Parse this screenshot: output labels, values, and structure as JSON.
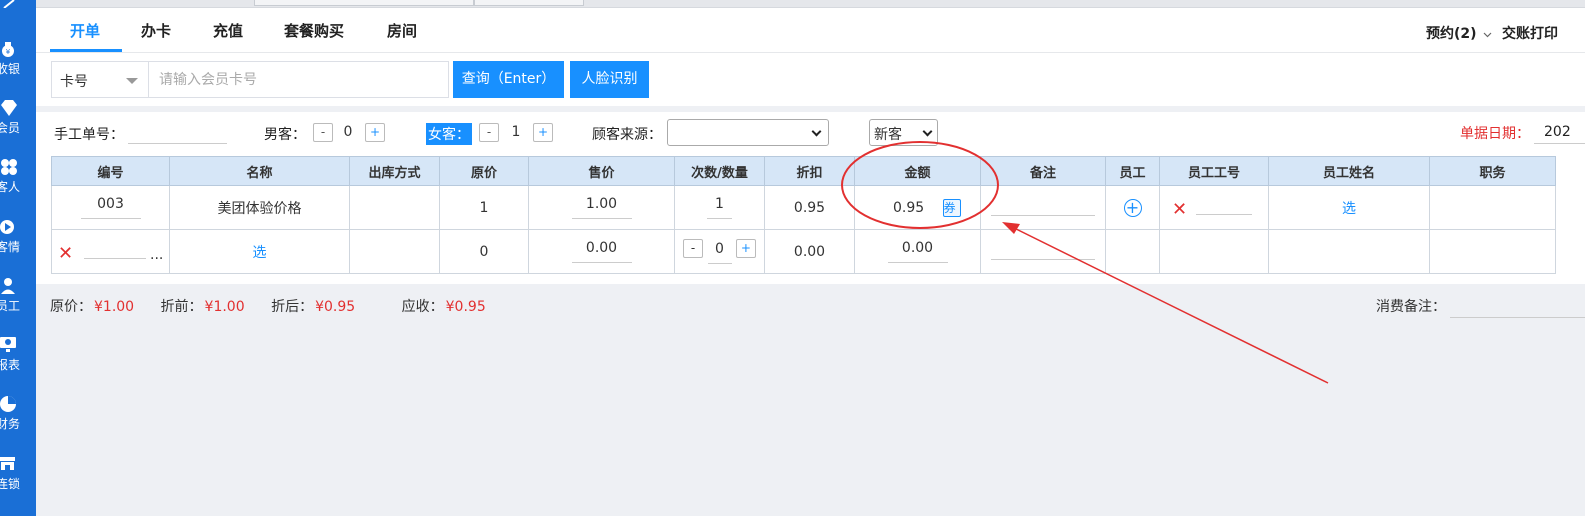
{
  "sidebar": {
    "items": [
      {
        "label": "收银",
        "icon": "money-bag-icon"
      },
      {
        "label": "会员",
        "icon": "diamond-icon"
      },
      {
        "label": "客人",
        "icon": "people-icon"
      },
      {
        "label": "客情",
        "icon": "play-circle-icon"
      },
      {
        "label": "员工",
        "icon": "person-icon"
      },
      {
        "label": "报表",
        "icon": "monitor-icon"
      },
      {
        "label": "财务",
        "icon": "pie-chart-icon"
      },
      {
        "label": "连锁",
        "icon": "store-icon"
      }
    ]
  },
  "tabs": {
    "items": [
      "开单",
      "办卡",
      "充值",
      "套餐购买",
      "房间"
    ],
    "active": "开单"
  },
  "header": {
    "reservation": "预约(2)",
    "print": "交账打印"
  },
  "search": {
    "type_label": "卡号",
    "placeholder": "请输入会员卡号",
    "query_button": "查询（Enter）",
    "face_button": "人脸识别"
  },
  "info": {
    "manual_no_label": "手工单号：",
    "male_label": "男客：",
    "male_count": "0",
    "female_label": "女客：",
    "female_count": "1",
    "source_label": "顾客来源：",
    "source_value": "",
    "customer_type": "新客",
    "date_label": "单据日期：",
    "date_value": "202"
  },
  "table": {
    "headers": [
      "编号",
      "名称",
      "出库方式",
      "原价",
      "售价",
      "次数/数量",
      "折扣",
      "金额",
      "备注",
      "员工",
      "员工工号",
      "员工姓名",
      "职务"
    ],
    "row1": {
      "code": "003",
      "name": "美团体验价格",
      "stock_method": "",
      "original_price": "1",
      "sale_price": "1.00",
      "quantity": "1",
      "discount": "0.95",
      "amount": "0.95",
      "coupon": "券",
      "choose": "选"
    },
    "row2": {
      "more": "...",
      "choose": "选",
      "original_price": "0",
      "sale_price": "0.00",
      "quantity": "0",
      "discount": "0.00",
      "amount": "0.00"
    }
  },
  "summary": {
    "original_label": "原价：",
    "original_value": "¥1.00",
    "before_label": "折前：",
    "before_value": "¥1.00",
    "after_label": "折后：",
    "after_value": "¥0.95",
    "receivable_label": "应收：",
    "receivable_value": "¥0.95",
    "note_label": "消费备注："
  },
  "colors": {
    "primary": "#1890ff",
    "sidebar": "#1a6fd6",
    "danger": "#e23030"
  }
}
